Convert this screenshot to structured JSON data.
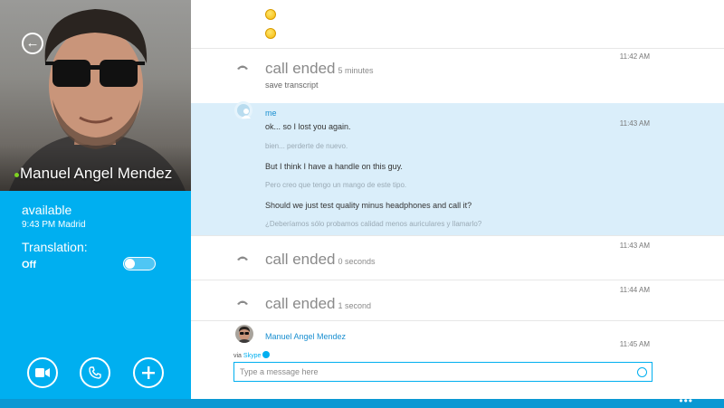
{
  "contact": {
    "name": "Manuel Angel Mendez",
    "status": "available",
    "local_time": "9:43 PM Madrid",
    "presence_color": "#7ed321"
  },
  "translation": {
    "label": "Translation:",
    "state": "Off",
    "enabled": false
  },
  "actions": {
    "video_icon": "video-camera-icon",
    "call_icon": "phone-icon",
    "add_icon": "plus-icon"
  },
  "conversation": {
    "call1": {
      "label": "call ended",
      "duration": "5 minutes",
      "time": "11:42 AM",
      "save": "save transcript"
    },
    "me_block": {
      "sender": "me",
      "time": "11:43 AM",
      "messages": [
        {
          "text": "ok... so I lost you again.",
          "translation": "bien... perderte de nuevo."
        },
        {
          "text": "But I think I have a handle on this guy.",
          "translation": "Pero creo que tengo un mango de este tipo."
        },
        {
          "text": "Should we just test quality minus headphones and call it?",
          "translation": "¿Deberíamos sólo probamos calidad menos auriculares y llamarlo?"
        }
      ]
    },
    "call2": {
      "label": "call ended",
      "duration": "0 seconds",
      "time": "11:43 AM"
    },
    "call3": {
      "label": "call ended",
      "duration": "1 second",
      "time": "11:44 AM"
    },
    "other": {
      "sender": "Manuel Angel Mendez",
      "time": "11:45 AM"
    }
  },
  "composer": {
    "via_prefix": "via",
    "via_service": "Skype",
    "placeholder": "Type a message here",
    "value": ""
  },
  "colors": {
    "accent": "#00aff0",
    "highlight": "#daeefa",
    "bottom_bar": "#0a98d3"
  },
  "appbar": {
    "more": "•••"
  }
}
